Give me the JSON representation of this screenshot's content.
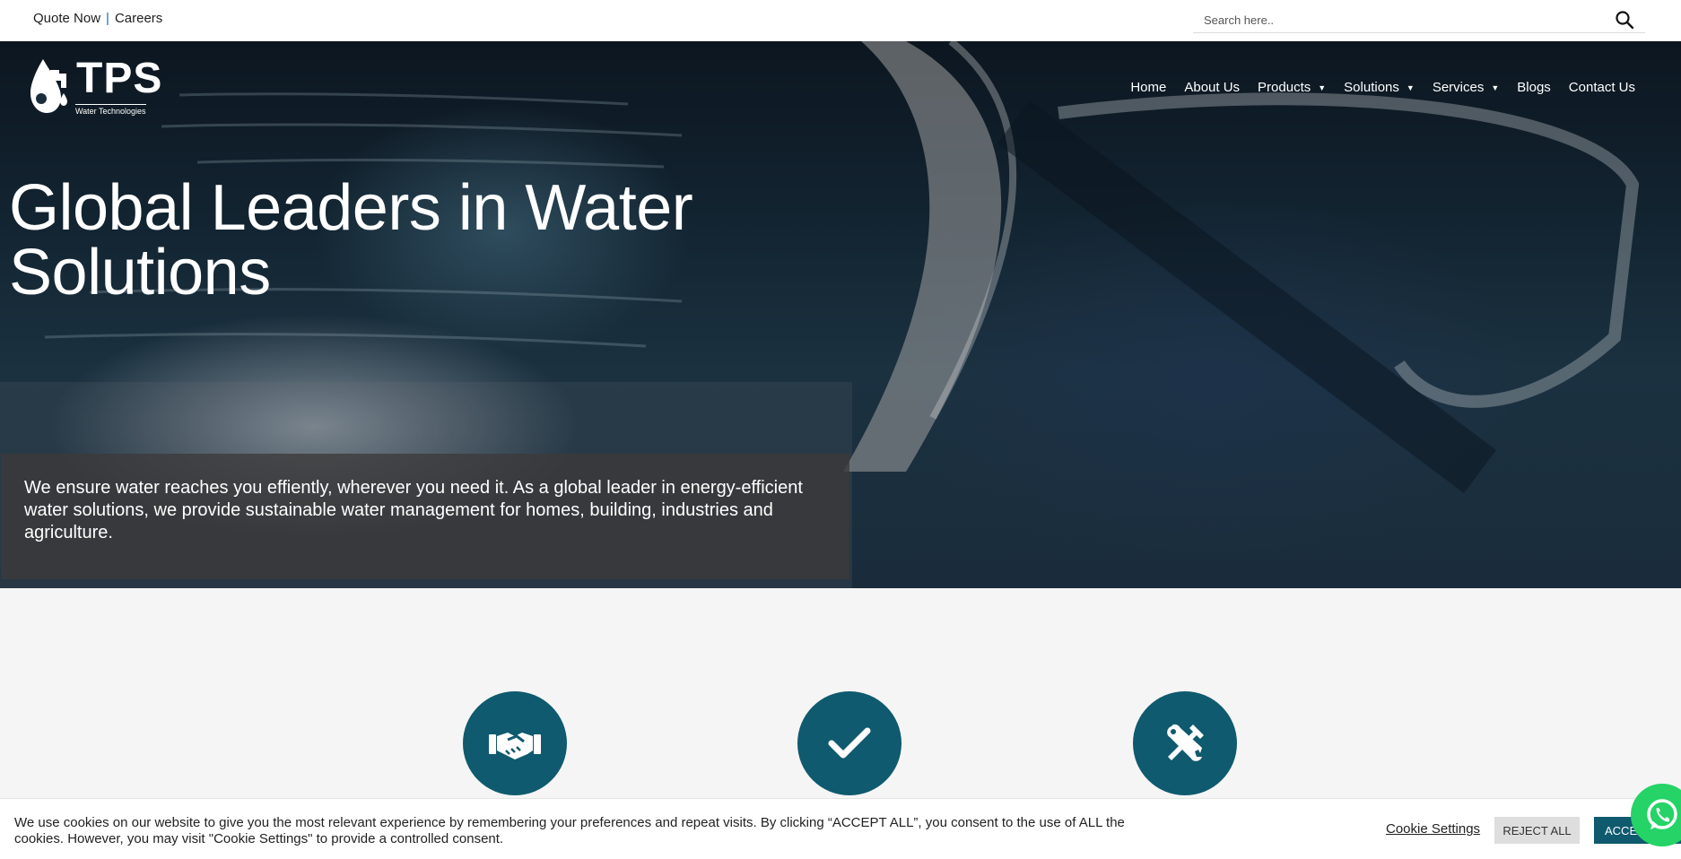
{
  "topbar": {
    "quote_now": "Quote Now",
    "separator": "|",
    "careers": "Careers",
    "search_placeholder": "Search here.."
  },
  "logo": {
    "title": "TPS",
    "subtitle": "Water Technologies"
  },
  "nav": {
    "items": [
      {
        "label": "Home",
        "dropdown": false
      },
      {
        "label": "About Us",
        "dropdown": false
      },
      {
        "label": "Products",
        "dropdown": true
      },
      {
        "label": "Solutions",
        "dropdown": true
      },
      {
        "label": "Services",
        "dropdown": true
      },
      {
        "label": "Blogs",
        "dropdown": false
      },
      {
        "label": "Contact Us",
        "dropdown": false
      }
    ],
    "caret": "▼"
  },
  "hero": {
    "title_line1": "Global Leaders in Water",
    "title_line2": "Solutions",
    "description": "We ensure water reaches you effiently, wherever you need it. As a global leader in energy-efficient water solutions, we provide sustainable water management for homes, building, industries and agriculture."
  },
  "features": [
    {
      "icon": "handshake-icon"
    },
    {
      "icon": "checkmark-icon"
    },
    {
      "icon": "tools-icon"
    }
  ],
  "cookie": {
    "message": "We use cookies on our website to give you the most relevant experience by remembering your preferences and repeat visits. By clicking “ACCEPT ALL”, you consent to the use of ALL the cookies. However, you may visit \"Cookie Settings\" to provide a controlled consent.",
    "settings_label": "Cookie Settings",
    "reject_label": "REJECT ALL",
    "accept_label": "ACCEPT ALL"
  },
  "colors": {
    "accent": "#0f5a6e",
    "whatsapp": "#25d366",
    "topbar_separator": "#1a6bbd"
  }
}
